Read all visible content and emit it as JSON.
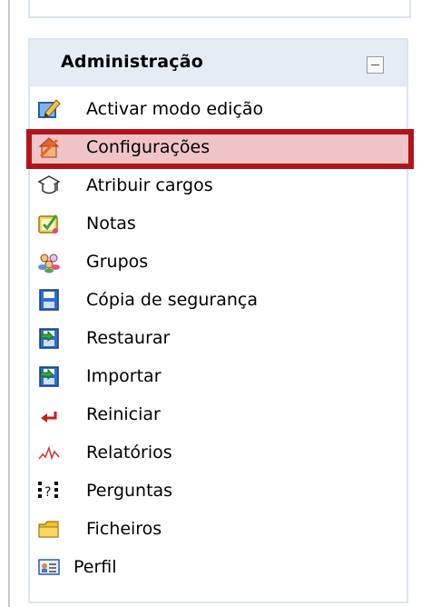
{
  "block": {
    "title": "Administração",
    "items": [
      {
        "label": "Activar modo edição",
        "icon": "edit-pencil-icon"
      },
      {
        "label": "Configurações",
        "icon": "settings-icon",
        "highlighted": true
      },
      {
        "label": "Atribuir cargos",
        "icon": "roles-icon"
      },
      {
        "label": "Notas",
        "icon": "grades-icon"
      },
      {
        "label": "Grupos",
        "icon": "groups-icon"
      },
      {
        "label": "Cópia de segurança",
        "icon": "backup-icon"
      },
      {
        "label": "Restaurar",
        "icon": "restore-icon"
      },
      {
        "label": "Importar",
        "icon": "import-icon"
      },
      {
        "label": "Reiniciar",
        "icon": "reset-arrow-icon"
      },
      {
        "label": "Relatórios",
        "icon": "reports-icon"
      },
      {
        "label": "Perguntas",
        "icon": "questions-icon"
      },
      {
        "label": "Ficheiros",
        "icon": "folder-icon"
      },
      {
        "label": "Perfil",
        "icon": "profile-icon"
      }
    ]
  },
  "colors": {
    "highlight_border": "#b3141a",
    "highlight_fill": "#f0c4c7",
    "header_bg": "#e6ecf4"
  }
}
